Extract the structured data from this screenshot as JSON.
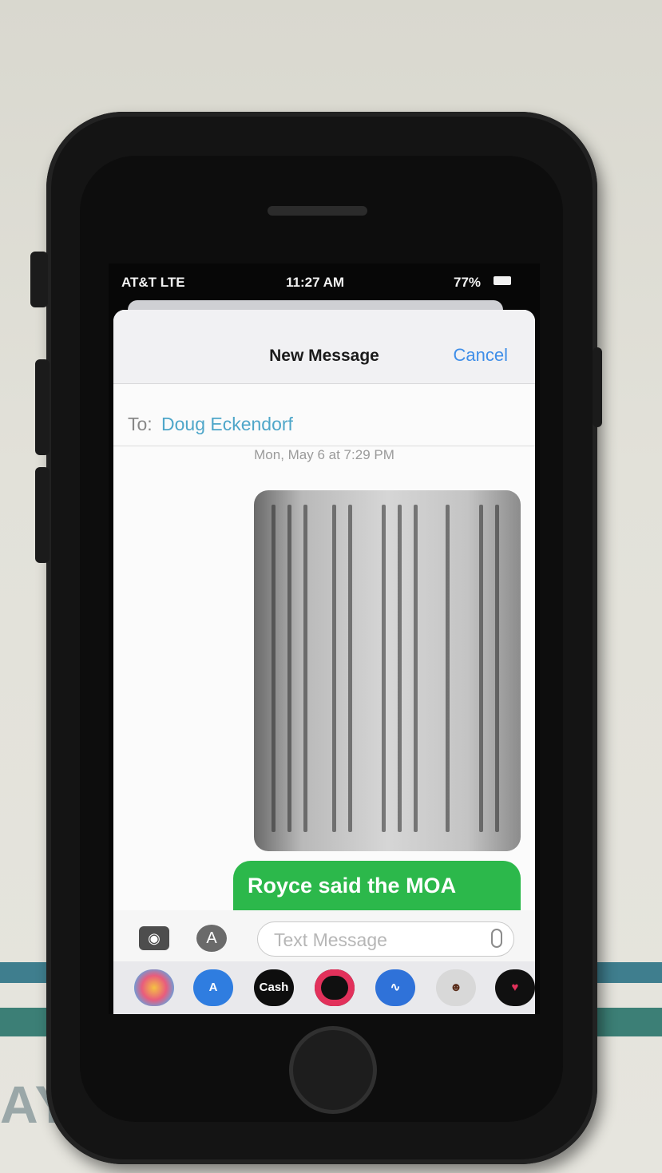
{
  "status_bar": {
    "carrier": "AT&T LTE",
    "time": "11:27 AM",
    "battery": "77%"
  },
  "compose": {
    "title": "New Message",
    "cancel_label": "Cancel",
    "to_label": "To:",
    "recipient": "Doug Eckendorf"
  },
  "conversation": {
    "timestamp": "Mon, May 6 at 7:29 PM",
    "sent_message": "Royce said the MOA"
  },
  "input": {
    "placeholder": "Text Message"
  },
  "app_drawer": {
    "apps": [
      {
        "icon": "photos-icon"
      },
      {
        "icon": "app-store-icon"
      },
      {
        "icon": "apple-cash-icon",
        "label": "Cash"
      },
      {
        "icon": "activity-icon"
      },
      {
        "icon": "audio-message-icon"
      },
      {
        "icon": "memoji-icon"
      },
      {
        "icon": "digital-touch-icon"
      }
    ]
  },
  "colors": {
    "link_blue": "#3f8ee8",
    "recipient_blue": "#4ea6c9",
    "sms_green": "#2cb84b"
  }
}
